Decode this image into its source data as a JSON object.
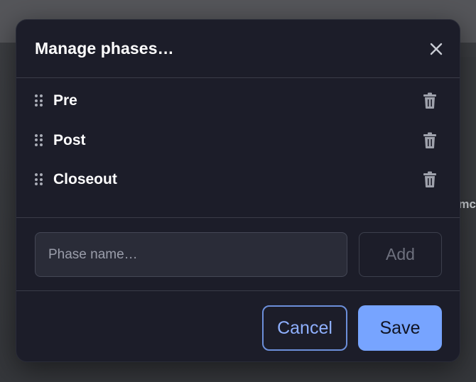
{
  "background": {
    "partial_text": "mc"
  },
  "dialog": {
    "title": "Manage phases…",
    "close_icon": "close-icon",
    "phases": [
      {
        "label": "Pre"
      },
      {
        "label": "Post"
      },
      {
        "label": "Closeout"
      }
    ],
    "drag_icon": "drag-handle-icon",
    "delete_icon": "trash-icon",
    "input": {
      "placeholder": "Phase name…",
      "value": ""
    },
    "add_label": "Add",
    "cancel_label": "Cancel",
    "save_label": "Save"
  },
  "colors": {
    "dialog_bg": "#1c1d29",
    "accent": "#77a4ff",
    "accent_text": "#8fb0ff",
    "divider": "#3a3c48"
  }
}
